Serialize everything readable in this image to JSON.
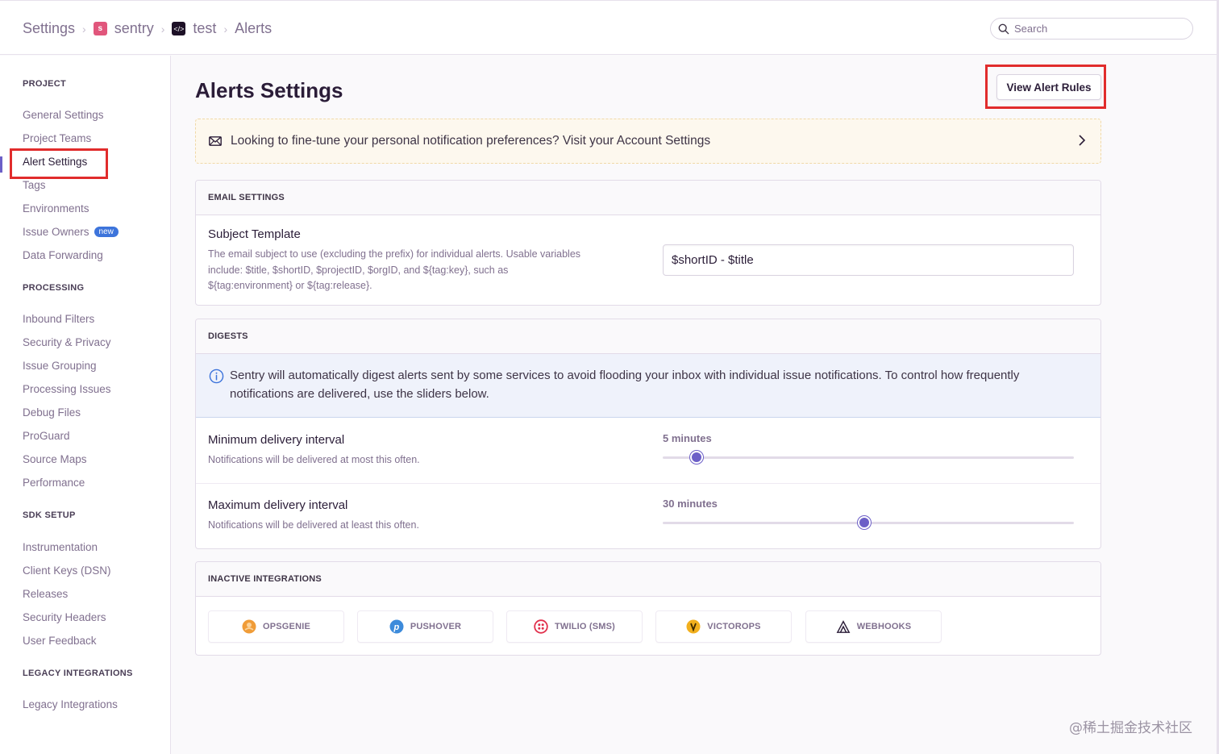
{
  "breadcrumb": {
    "settings": "Settings",
    "org_badge": "s",
    "org": "sentry",
    "project_badge": "</>",
    "project": "test",
    "current": "Alerts"
  },
  "search": {
    "placeholder": "Search"
  },
  "sidebar": {
    "sections": [
      {
        "title": "PROJECT",
        "items": [
          "General Settings",
          "Project Teams",
          "Alert Settings",
          "Tags",
          "Environments",
          "Issue Owners",
          "Data Forwarding"
        ]
      },
      {
        "title": "PROCESSING",
        "items": [
          "Inbound Filters",
          "Security & Privacy",
          "Issue Grouping",
          "Processing Issues",
          "Debug Files",
          "ProGuard",
          "Source Maps",
          "Performance"
        ]
      },
      {
        "title": "SDK SETUP",
        "items": [
          "Instrumentation",
          "Client Keys (DSN)",
          "Releases",
          "Security Headers",
          "User Feedback"
        ]
      },
      {
        "title": "LEGACY INTEGRATIONS",
        "items": [
          "Legacy Integrations"
        ]
      }
    ],
    "active_item": "Alert Settings",
    "new_badge": "new"
  },
  "main": {
    "title": "Alerts Settings",
    "view_rules_button": "View Alert Rules",
    "notice": "Looking to fine-tune your personal notification preferences? Visit your Account Settings",
    "email": {
      "header": "EMAIL SETTINGS",
      "label": "Subject Template",
      "help_lines": [
        "The email subject to use (excluding the prefix) for individual alerts. Usable variables",
        "include: $title, $shortID, $projectID, $orgID, and ${tag:key}, such as",
        "${tag:environment} or ${tag:release}."
      ],
      "value": "$shortID - $title"
    },
    "digests": {
      "header": "DIGESTS",
      "info": "Sentry will automatically digest alerts sent by some services to avoid flooding your inbox with individual issue notifications. To control how frequently notifications are delivered, use the sliders below.",
      "min": {
        "label": "Minimum delivery interval",
        "help": "Notifications will be delivered at most this often.",
        "value": "5 minutes",
        "position": 0.083
      },
      "max": {
        "label": "Maximum delivery interval",
        "help": "Notifications will be delivered at least this often.",
        "value": "30 minutes",
        "position": 0.49
      }
    },
    "integrations": {
      "header": "INACTIVE INTEGRATIONS",
      "items": [
        "OPSGENIE",
        "PUSHOVER",
        "TWILIO (SMS)",
        "VICTOROPS",
        "WEBHOOKS"
      ]
    }
  },
  "watermark": "@稀土掘金技术社区",
  "colors": {
    "accent": "#6c5fc7",
    "highlight": "#e12c2c",
    "notice_bg": "#fdf8ee",
    "info_bg": "#eff2fb"
  }
}
